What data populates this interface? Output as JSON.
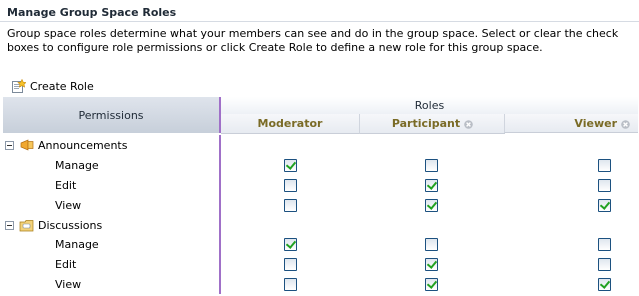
{
  "page": {
    "title": "Manage Group Space Roles",
    "description": "Group space roles determine what your members can see and do in the group space. Select or clear the check boxes to configure role permissions or click Create Role to define a new role for this group space."
  },
  "toolbar": {
    "create_role_label": "Create Role"
  },
  "table": {
    "permissions_header": "Permissions",
    "roles_header": "Roles",
    "roles": [
      {
        "name": "Moderator",
        "deletable": false
      },
      {
        "name": "Participant",
        "deletable": true
      },
      {
        "name": "Viewer",
        "deletable": true
      }
    ],
    "groups": [
      {
        "name": "Announcements",
        "icon": "megaphone-icon",
        "rows": [
          {
            "label": "Manage",
            "checks": [
              true,
              false,
              false
            ]
          },
          {
            "label": "Edit",
            "checks": [
              false,
              true,
              false
            ]
          },
          {
            "label": "View",
            "checks": [
              false,
              true,
              true
            ]
          }
        ]
      },
      {
        "name": "Discussions",
        "icon": "discussion-folder-icon",
        "rows": [
          {
            "label": "Manage",
            "checks": [
              true,
              false,
              false
            ]
          },
          {
            "label": "Edit",
            "checks": [
              false,
              true,
              false
            ]
          },
          {
            "label": "View",
            "checks": [
              false,
              true,
              true
            ]
          }
        ]
      }
    ]
  },
  "colors": {
    "role_header_text": "#7a6b26",
    "check_green": "#21a121",
    "divider_purple": "#a070c8"
  }
}
